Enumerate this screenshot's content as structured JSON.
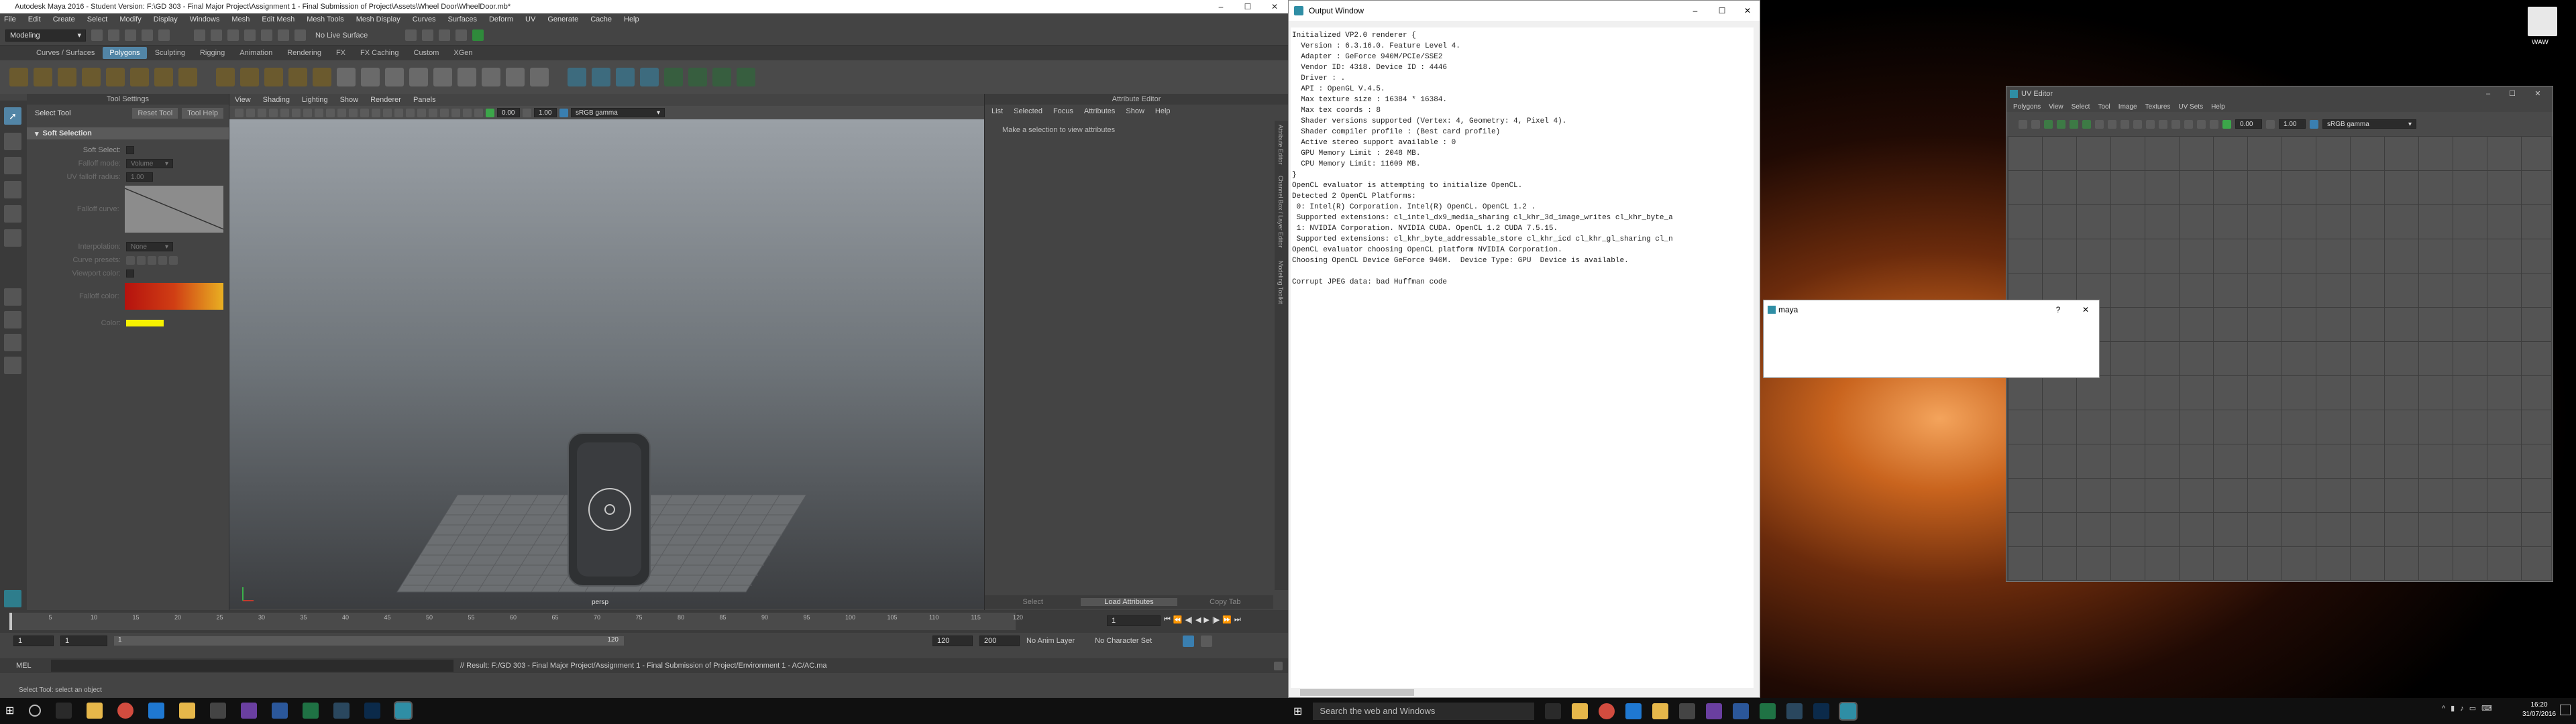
{
  "maya": {
    "title": "Autodesk Maya 2016 - Student Version: F:\\GD 303 - Final Major Project\\Assignment 1 - Final Submission of Project\\Assets\\Wheel Door\\WheelDoor.mb*",
    "menus": [
      "File",
      "Edit",
      "Create",
      "Select",
      "Modify",
      "Display",
      "Windows",
      "Mesh",
      "Edit Mesh",
      "Mesh Tools",
      "Mesh Display",
      "Curves",
      "Surfaces",
      "Deform",
      "UV",
      "Generate",
      "Cache",
      "Help"
    ],
    "mode": "Modeling",
    "live_surface": "No Live Surface",
    "shelf_tabs": [
      "Curves / Surfaces",
      "Polygons",
      "Sculpting",
      "Rigging",
      "Animation",
      "Rendering",
      "FX",
      "FX Caching",
      "Custom",
      "XGen"
    ],
    "active_shelf_tab": "Polygons",
    "tool_settings": {
      "header": "Tool Settings",
      "tool_name": "Select Tool",
      "reset": "Reset Tool",
      "help": "Tool Help",
      "section": "Soft Selection",
      "rows": [
        {
          "label": "Soft Select:",
          "type": "checkbox"
        },
        {
          "label": "Falloff mode:",
          "type": "dropdown",
          "value": "Volume"
        },
        {
          "label": "UV falloff radius:",
          "type": "field",
          "value": "1.00"
        },
        {
          "label": "Falloff curve:",
          "type": "curve"
        },
        {
          "label": "Interpolation:",
          "type": "dropdown",
          "value": "None"
        },
        {
          "label": "Curve presets:",
          "type": "presets"
        },
        {
          "label": "Viewport color:",
          "type": "checkbox"
        },
        {
          "label": "Falloff color:",
          "type": "gradient"
        },
        {
          "label": "Color:",
          "type": "swatch"
        }
      ]
    },
    "viewport": {
      "menus": [
        "View",
        "Shading",
        "Lighting",
        "Show",
        "Renderer",
        "Panels"
      ],
      "value1": "0.00",
      "value2": "1.00",
      "colorspace": "sRGB gamma",
      "camera": "persp"
    },
    "attr_editor": {
      "title": "Attribute Editor",
      "menus": [
        "List",
        "Selected",
        "Focus",
        "Attributes",
        "Show",
        "Help"
      ],
      "message": "Make a selection to view attributes",
      "buttons": [
        "Select",
        "Load Attributes",
        "Copy Tab"
      ],
      "side_tabs": [
        "Attribute Editor",
        "Channel Box / Layer Editor",
        "Modeling Toolkit"
      ]
    },
    "timeline": {
      "ticks": [
        "5",
        "10",
        "15",
        "20",
        "25",
        "30",
        "35",
        "40",
        "45",
        "50",
        "55",
        "60",
        "65",
        "70",
        "75",
        "80",
        "85",
        "90",
        "95",
        "100",
        "105",
        "110",
        "115",
        "120"
      ],
      "current_frame": "1"
    },
    "range": {
      "start": "1",
      "anim_start": "1",
      "range_end": "120",
      "anim_end": "120",
      "end": "200",
      "anim_layer": "No Anim Layer",
      "char_set": "No Character Set"
    },
    "cmd": {
      "lang": "MEL",
      "result": "// Result: F:/GD 303 - Final Major Project/Assignment 1 - Final Submission of Project/Environment 1 - AC/AC.ma"
    },
    "help_line": "Select Tool: select an object"
  },
  "output": {
    "title": "Output Window",
    "text": "Initialized VP2.0 renderer {\n  Version : 6.3.16.0. Feature Level 4.\n  Adapter : GeForce 940M/PCIe/SSE2\n  Vendor ID: 4318. Device ID : 4446\n  Driver : .\n  API : OpenGL V.4.5.\n  Max texture size : 16384 * 16384.\n  Max tex coords : 8\n  Shader versions supported (Vertex: 4, Geometry: 4, Pixel 4).\n  Shader compiler profile : (Best card profile)\n  Active stereo support available : 0\n  GPU Memory Limit : 2048 MB.\n  CPU Memory Limit: 11609 MB.\n}\nOpenCL evaluator is attempting to initialize OpenCL.\nDetected 2 OpenCL Platforms:\n 0: Intel(R) Corporation. Intel(R) OpenCL. OpenCL 1.2 .\n Supported extensions: cl_intel_dx9_media_sharing cl_khr_3d_image_writes cl_khr_byte_a\n 1: NVIDIA Corporation. NVIDIA CUDA. OpenCL 1.2 CUDA 7.5.15.\n Supported extensions: cl_khr_byte_addressable_store cl_khr_icd cl_khr_gl_sharing cl_n\nOpenCL evaluator choosing OpenCL platform NVIDIA Corporation.\nChoosing OpenCL Device GeForce 940M.  Device Type: GPU  Device is available.\n\nCorrupt JPEG data: bad Huffman code"
  },
  "uv_editor": {
    "title": "UV Editor",
    "menus": [
      "Polygons",
      "View",
      "Select",
      "Tool",
      "Image",
      "Textures",
      "UV Sets",
      "Help"
    ],
    "value1": "0.00",
    "value2": "1.00",
    "colorspace": "sRGB gamma"
  },
  "dialog": {
    "title": "maya",
    "help": "?",
    "close": "✕"
  },
  "desktop_icon_label": "WAW",
  "taskbar": {
    "search": "Search the web and Windows",
    "time": "16:20",
    "date": "31/07/2016"
  }
}
